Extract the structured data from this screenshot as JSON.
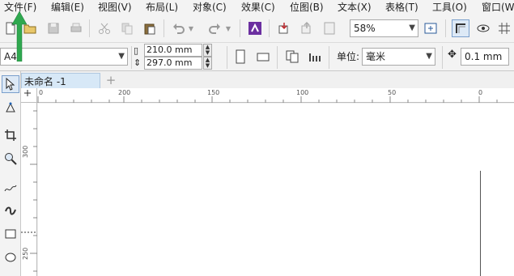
{
  "menubar": {
    "items": [
      "文件(F)",
      "编辑(E)",
      "视图(V)",
      "布局(L)",
      "对象(C)",
      "效果(C)",
      "位图(B)",
      "文本(X)",
      "表格(T)",
      "工具(O)",
      "窗口(W)"
    ]
  },
  "toolbar": {
    "zoom_value": "58%"
  },
  "property_bar": {
    "page_size": "A4",
    "width": "210.0 mm",
    "height": "297.0 mm",
    "units_label": "单位:",
    "units_value": "毫米",
    "nudge_value": "0.1 mm"
  },
  "document": {
    "tab_title": "未命名 -1",
    "add_tab": "+"
  },
  "ruler": {
    "h_labels": [
      "0",
      "200",
      "150",
      "100",
      "50",
      "0"
    ],
    "v_labels": [
      "300",
      "250"
    ]
  },
  "colors": {
    "annotation_arrow": "#2fa84f",
    "tab_active": "#d7e8f7",
    "effects_icon": "#6b2fa0"
  },
  "icons": [
    "new-icon",
    "open-icon",
    "save-icon",
    "print-icon",
    "cut-icon",
    "copy-icon",
    "paste-icon",
    "undo-icon",
    "redo-icon",
    "search-content-icon",
    "import-icon",
    "export-icon",
    "publish-pdf-icon",
    "full-screen-icon",
    "snap-icon",
    "view-icon",
    "pick-tool-icon",
    "shape-tool-icon",
    "crop-tool-icon",
    "zoom-tool-icon",
    "freehand-tool-icon",
    "artistic-media-icon",
    "rectangle-tool-icon",
    "ellipse-tool-icon"
  ]
}
